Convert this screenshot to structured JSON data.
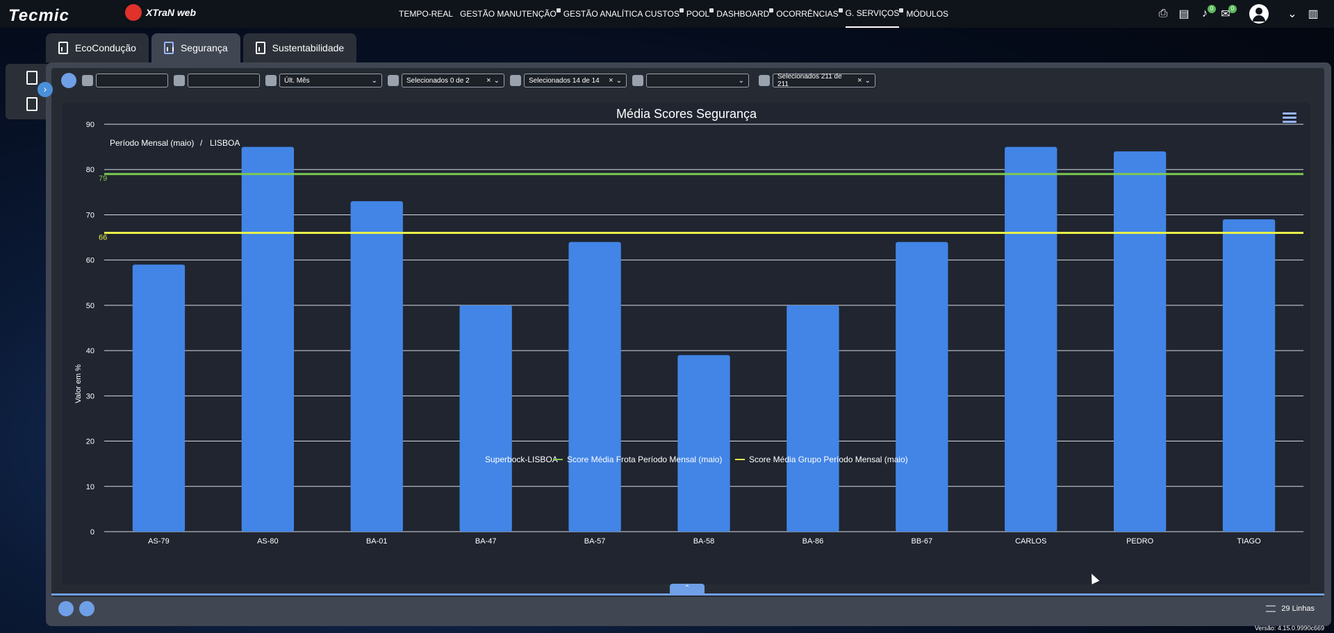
{
  "brand": {
    "tecmic": "Tecmic",
    "xtran": "XTraN web"
  },
  "nav": [
    {
      "label": "TEMPO-REAL",
      "locked": false,
      "active": false
    },
    {
      "label": "GESTÃO MANUTENÇÃO",
      "locked": true,
      "active": false
    },
    {
      "label": "GESTÃO ANALÍTICA CUSTOS",
      "locked": true,
      "active": false
    },
    {
      "label": "POOL",
      "locked": true,
      "active": false
    },
    {
      "label": "DASHBOARD",
      "locked": true,
      "active": false
    },
    {
      "label": "OCORRÊNCIAS",
      "locked": true,
      "active": false
    },
    {
      "label": "G. SERVIÇOS",
      "locked": true,
      "active": true
    },
    {
      "label": "MÓDULOS",
      "locked": false,
      "active": false
    }
  ],
  "notifications": {
    "alerts_count": "0",
    "messages_count": "0"
  },
  "tabs": [
    "EcoCondução",
    "Segurança",
    "Sustentabilidade"
  ],
  "filters": {
    "date_from": "",
    "date_to": "",
    "period": "Últ. Mês",
    "company_select": "Selecionados 0 de 2",
    "groups_select": "Selecionados 14 de 14",
    "type_select": "",
    "vehicles_select": "Selecionados 211 de 211"
  },
  "chart_data": {
    "type": "bar",
    "title": "Média Scores Segurança",
    "breadcrumb": [
      "Período Mensal (maio)",
      "LISBOA"
    ],
    "breadcrumb_sep": "/",
    "ylabel": "Valor em %",
    "ylim": [
      0,
      90
    ],
    "yticks": [
      "0",
      "10",
      "20",
      "30",
      "40",
      "50",
      "60",
      "70",
      "80",
      "90"
    ],
    "categories": [
      "AS-79",
      "AS-80",
      "BA-01",
      "BA-47",
      "BA-57",
      "BA-58",
      "BA-86",
      "BB-67",
      "CARLOS",
      "PEDRO",
      "TIAGO"
    ],
    "series": [
      {
        "name": "Superbock-LISBOA",
        "color": "#4285e6",
        "values": [
          59,
          85,
          73,
          50,
          64,
          39,
          50,
          64,
          85,
          84,
          69
        ]
      }
    ],
    "reference_lines": [
      {
        "name": "Score Média Frota Período Mensal (maio)",
        "value": 79,
        "label": "79",
        "color": "#7ec850"
      },
      {
        "name": "Score Média Grupo Período Mensal (maio)",
        "value": 66,
        "label": "66",
        "color": "#e8f04a"
      }
    ],
    "grid": true,
    "legend": "bottom-center"
  },
  "footer": {
    "lines": "29 Linhas",
    "version": "Versão: 4.15.0.9990c669"
  }
}
